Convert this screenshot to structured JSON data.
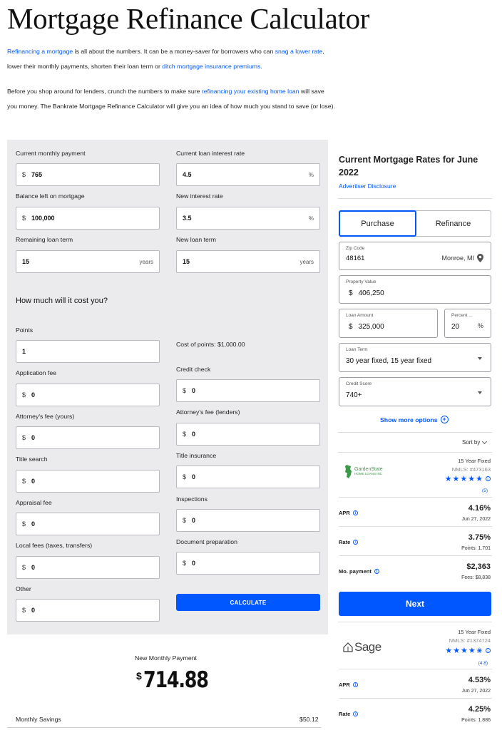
{
  "page": {
    "title": "Mortgage Refinance Calculator",
    "intro1": {
      "link1": "Refinancing a mortgage",
      "t1": " is all about the numbers. It can be a money-saver for borrowers who can ",
      "link2": "snag a lower rate",
      "t2": ", lower their monthly payments, shorten their loan term or ",
      "link3": "ditch mortgage insurance premiums",
      "t3": "."
    },
    "intro2": {
      "t1": "Before you shop around for lenders, crunch the numbers to make sure ",
      "link1": "refinancing your existing home loan",
      "t2": " will save you money. The Bankrate Mortgage Refinance Calculator will give you an idea of how much you stand to save (or lose)."
    }
  },
  "calculator": {
    "current_payment": {
      "label": "Current monthly payment",
      "prefix": "$",
      "value": "765"
    },
    "current_rate": {
      "label": "Current loan interest rate",
      "value": "4.5",
      "suffix": "%"
    },
    "balance": {
      "label": "Balance left on mortgage",
      "prefix": "$",
      "value": "100,000"
    },
    "new_rate": {
      "label": "New interest rate",
      "value": "3.5",
      "suffix": "%"
    },
    "remaining_term": {
      "label": "Remaining loan term",
      "value": "15",
      "suffix": "years"
    },
    "new_term": {
      "label": "New loan term",
      "value": "15",
      "suffix": "years"
    },
    "cost_heading": "How much will it cost you?",
    "points": {
      "label": "Points",
      "value": "1"
    },
    "cost_of_points": "Cost of points: $1,000.00",
    "application_fee": {
      "label": "Application fee",
      "prefix": "$",
      "value": "0"
    },
    "credit_check": {
      "label": "Credit check",
      "prefix": "$",
      "value": "0"
    },
    "attorney_yours": {
      "label": "Attorney's fee (yours)",
      "prefix": "$",
      "value": "0"
    },
    "attorney_lenders": {
      "label": "Attorney's fee (lenders)",
      "prefix": "$",
      "value": "0"
    },
    "title_search": {
      "label": "Title search",
      "prefix": "$",
      "value": "0"
    },
    "title_insurance": {
      "label": "Title insurance",
      "prefix": "$",
      "value": "0"
    },
    "appraisal_fee": {
      "label": "Appraisal fee",
      "prefix": "$",
      "value": "0"
    },
    "inspections": {
      "label": "Inspections",
      "prefix": "$",
      "value": "0"
    },
    "local_fees": {
      "label": "Local fees (taxes, transfers)",
      "prefix": "$",
      "value": "0"
    },
    "document_prep": {
      "label": "Document preparation",
      "prefix": "$",
      "value": "0"
    },
    "other": {
      "label": "Other",
      "prefix": "$",
      "value": "0"
    },
    "calculate_label": "CALCULATE"
  },
  "results": {
    "new_payment_label": "New Monthly Payment",
    "new_payment_currency": "$",
    "new_payment_value": "714.88",
    "savings_label": "Monthly Savings",
    "savings_value": "$50.12"
  },
  "rates_panel": {
    "title": "Current Mortgage Rates for June 2022",
    "disclosure": "Advertiser Disclosure",
    "tabs": [
      "Purchase",
      "Refinance"
    ],
    "active_tab": "Purchase",
    "zip": {
      "label": "Zip Code",
      "value": "48161",
      "location": "Monroe, MI"
    },
    "property_value": {
      "label": "Property Value",
      "prefix": "$",
      "value": "406,250"
    },
    "loan_amount": {
      "label": "Loan Amount",
      "prefix": "$",
      "value": "325,000"
    },
    "percent": {
      "label": "Percent ...",
      "value": "20",
      "suffix": "%"
    },
    "loan_term": {
      "label": "Loan Term",
      "value": "30 year fixed, 15 year fixed"
    },
    "credit_score": {
      "label": "Credit Score",
      "value": "740+"
    },
    "more_options": "Show more options",
    "sort_by": "Sort by",
    "next_label": "Next",
    "lenders": [
      {
        "name": "GardenState HOME LOANS INC",
        "type": "15 Year Fixed",
        "nmls": "NMLS: #473163",
        "rating": 5,
        "stars": "★★★★★",
        "review_count": "(5)",
        "apr_label": "APR",
        "apr": "4.16%",
        "apr_date": "Jun 27, 2022",
        "rate_label": "Rate",
        "rate": "3.75%",
        "points": "Points: 1.701",
        "payment_label": "Mo. payment",
        "payment": "$2,363",
        "fees": "Fees: $8,838"
      },
      {
        "name": "Sage",
        "type": "15 Year Fixed",
        "nmls": "NMLS: #1374724",
        "rating": 4.8,
        "stars": "★★★★✬",
        "review_count": "(4.8)",
        "apr_label": "APR",
        "apr": "4.53%",
        "apr_date": "Jun 27, 2022",
        "rate_label": "Rate",
        "rate": "4.25%",
        "points": "Points: 1.886"
      }
    ]
  },
  "colors": {
    "accent": "#0157ff",
    "panel_bg": "#ebebed",
    "green_logo": "#3a9a47"
  }
}
